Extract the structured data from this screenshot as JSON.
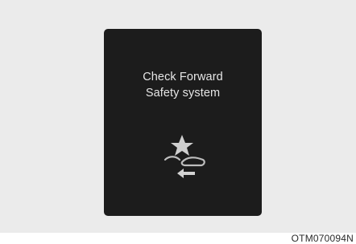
{
  "display": {
    "message_line_1": "Check Forward",
    "message_line_2": "Safety system",
    "icon": "forward-collision-warning-icon"
  },
  "figure": {
    "code": "OTM070094N"
  },
  "colors": {
    "panel_background": "#ebebeb",
    "screen_background": "#1c1c1c",
    "text": "#e6e6e6",
    "icon": "#c8c8c8"
  }
}
